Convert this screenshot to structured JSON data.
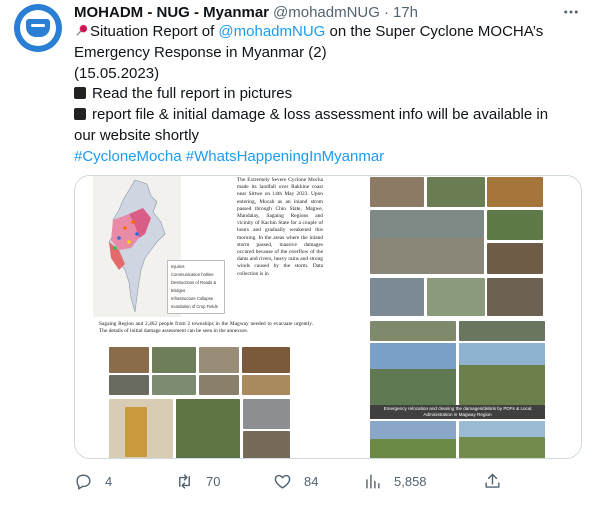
{
  "tweet": {
    "display_name": "MOHADM - NUG - Myanmar",
    "handle": "@mohadmNUG",
    "separator": "·",
    "time": "17h",
    "more_icon": "more-icon",
    "text": {
      "line1_prefix": "Situation Report of ",
      "line1_mention": "@mohadmNUG",
      "line1_suffix": " on the Super Cyclone MOCHA’s",
      "line2": "Emergency Response in Myanmar (2)",
      "line3": "(15.05.2023)",
      "line4": "Read the full report in pictures",
      "line5": "report file & initial damage & loss assessment info will be available in",
      "line6": "our website shortly",
      "hashtag1": "#CycloneMocha",
      "hashtag2": "#WhatsHappeningInMyanmar"
    },
    "media": {
      "image1_text": "The Extremely Severe Cyclone Mocha made its landfall over Rakhine coast near Sittwe on 14th May 2023. Upon entering, Mocah as an inland strom passed through Chin State, Magwe, Mandalay, Sagaing Regions and vicinity of Kachin State for a couple of hours and gradually weakened this morning. In the areas where the inland storm passed, massive damages occured because of the overflow of the dams and rivers, heavy rains and strong winds caused by the storm. Data collection is in",
      "image1_legend": [
        "Injuries",
        "Communication hotline",
        "Destructions of Roads & Bridges",
        "Infrastructure Collapse",
        "Inundation of Crop Fields"
      ],
      "image3_text": "Sagaing Region and 2,462 people from 2 townships in the Magway needed to evacuate urgently. The details of initial damage assessment can be seen in the annexure.",
      "image4_caption": "Emergency relocation and clearing the damages/debris by PDFs & Local Administration in Magway Region"
    },
    "actions": {
      "reply_count": "4",
      "retweet_count": "70",
      "like_count": "84",
      "views_count": "5,858"
    },
    "colors": {
      "link": "#1d9bf0",
      "secondary_text": "#536471",
      "primary_text": "#0f1419",
      "avatar_blue": "#2a7fd4"
    }
  }
}
